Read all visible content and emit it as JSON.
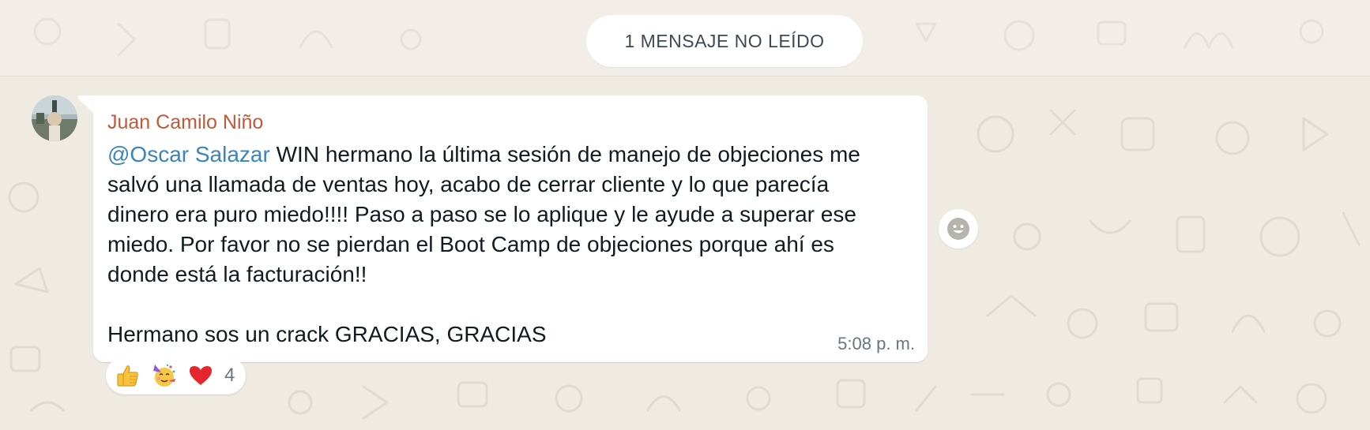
{
  "banner": {
    "unread_label": "1 MENSAJE NO LEÍDO"
  },
  "message": {
    "sender": "Juan Camilo Niño",
    "mention": "@Oscar Salazar",
    "text_line_1": "WIN hermano la última sesión de manejo de objeciones me",
    "text_line_2": "salvó una llamada de ventas hoy, acabo de cerrar cliente y lo que parecía",
    "text_line_3": "dinero era puro miedo!!!! Paso a paso se lo aplique y le ayude a superar ese",
    "text_line_4": "miedo. Por favor no se pierdan el Boot Camp de objeciones porque ahí es",
    "text_line_5": "donde está la facturación!!",
    "text_line_6": "Hermano sos un crack GRACIAS, GRACIAS",
    "timestamp": "5:08 p. m."
  },
  "reactions": {
    "emojis": [
      "thumbs-up",
      "partying-face",
      "red-heart"
    ],
    "count": "4"
  },
  "colors": {
    "background": "#efeae2",
    "sender_name": "#c0593b",
    "mention": "#3a83bd",
    "bubble": "#ffffff",
    "meta_text": "#667781"
  }
}
